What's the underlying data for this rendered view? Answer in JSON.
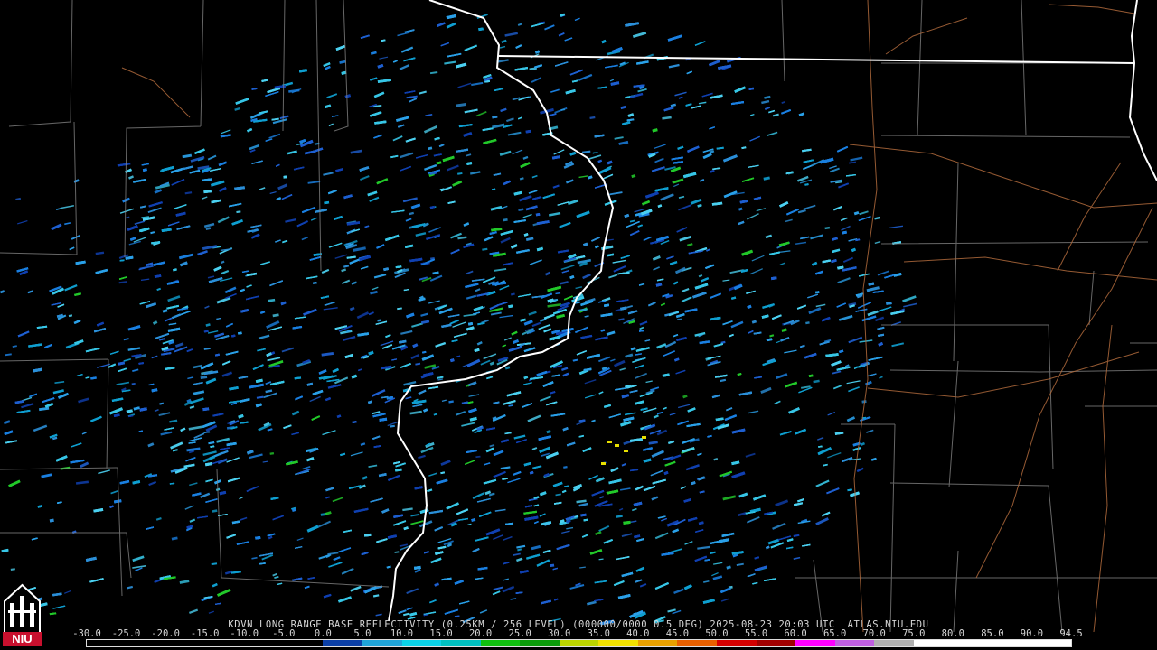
{
  "product": {
    "title": "KDVN LONG RANGE BASE REFLECTIVITY (0.25KM / 256 LEVEL) (000000/0000 0.5 DEG) 2025-08-23 20:03 UTC  ATLAS.NIU.EDU"
  },
  "logo": {
    "text": "NIU"
  },
  "legend": {
    "labels": [
      "-30.0",
      "-25.0",
      "-20.0",
      "-15.0",
      "-10.0",
      "-5.0",
      "0.0",
      "5.0",
      "10.0",
      "15.0",
      "20.0",
      "25.0",
      "30.0",
      "35.0",
      "40.0",
      "45.0",
      "50.0",
      "55.0",
      "60.0",
      "65.0",
      "70.0",
      "75.0",
      "80.0",
      "85.0",
      "90.0",
      "94.5"
    ],
    "colors": [
      "#000000",
      "#000000",
      "#000000",
      "#000000",
      "#000000",
      "#000000",
      "#0b3fa6",
      "#1fa3d6",
      "#0bd1e6",
      "#00c0c0",
      "#10c010",
      "#0b9b0b",
      "#bcd400",
      "#f0e000",
      "#e8a000",
      "#e86000",
      "#d40000",
      "#a00000",
      "#ff00ff",
      "#c060e0",
      "#b0b0b0",
      "#ffffff",
      "#ffffff",
      "#ffffff",
      "#ffffff"
    ]
  }
}
